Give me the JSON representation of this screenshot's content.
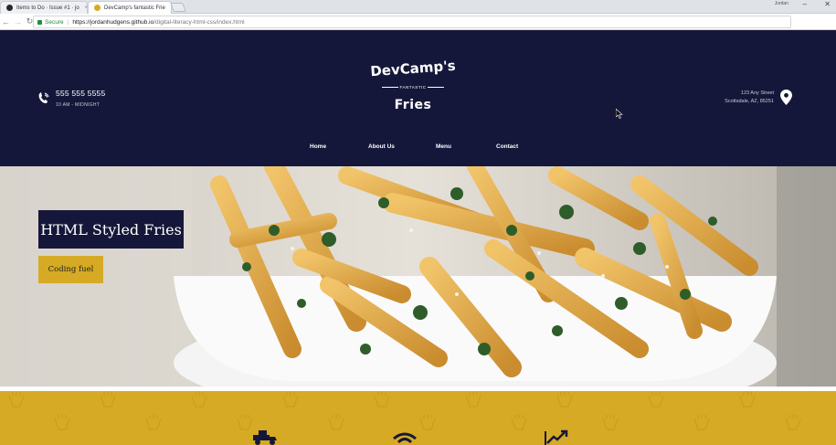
{
  "browser": {
    "tabs": [
      {
        "title": "Items to Do · Issue #1 · jo",
        "active": false,
        "favicon_color": "#24292e"
      },
      {
        "title": "DevCamp's fantastic Frie",
        "active": true,
        "favicon_color": "#d6aa24"
      }
    ],
    "user_label": "Jordan",
    "address": {
      "secure_label": "Secure",
      "host": "https://jordanhudgens.github.io",
      "path": "/digital-literacy-html-css/index.html"
    }
  },
  "site": {
    "colors": {
      "navy": "#15173a",
      "gold": "#d6aa24"
    },
    "header": {
      "phone": "555 555 5555",
      "hours": "10 AM - MIDNIGHT",
      "address_line1": "123 Any Street",
      "address_line2": "Scottsdale, AZ, 85251",
      "logo": {
        "top": "DevCamp's",
        "middle": "FANTASTIC",
        "bottom": "Fries"
      }
    },
    "nav": [
      {
        "label": "Home"
      },
      {
        "label": "About Us"
      },
      {
        "label": "Menu"
      },
      {
        "label": "Contact"
      }
    ],
    "hero": {
      "title": "HTML Styled Fries",
      "button": "Coding fuel"
    },
    "features": {
      "icons": [
        "truck-icon",
        "wifi-icon",
        "chart-trending-icon"
      ]
    }
  }
}
